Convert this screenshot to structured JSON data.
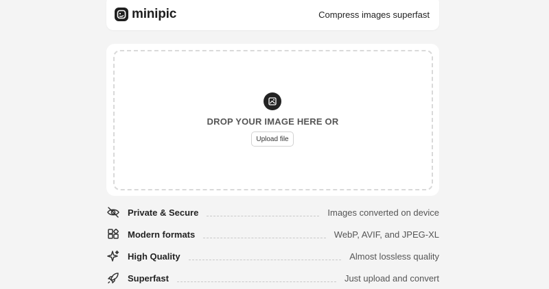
{
  "header": {
    "brand": "minipic",
    "tagline": "Compress images superfast"
  },
  "dropzone": {
    "prompt": "DROP YOUR IMAGE HERE OR",
    "upload_label": "Upload file"
  },
  "features": [
    {
      "icon": "eye-off-icon",
      "name": "Private & Secure",
      "desc": "Images converted on device"
    },
    {
      "icon": "shapes-icon",
      "name": "Modern formats",
      "desc": "WebP, AVIF, and JPEG-XL"
    },
    {
      "icon": "sparkles-icon",
      "name": "High Quality",
      "desc": "Almost lossless quality"
    },
    {
      "icon": "rocket-icon",
      "name": "Superfast",
      "desc": "Just upload and convert"
    }
  ]
}
